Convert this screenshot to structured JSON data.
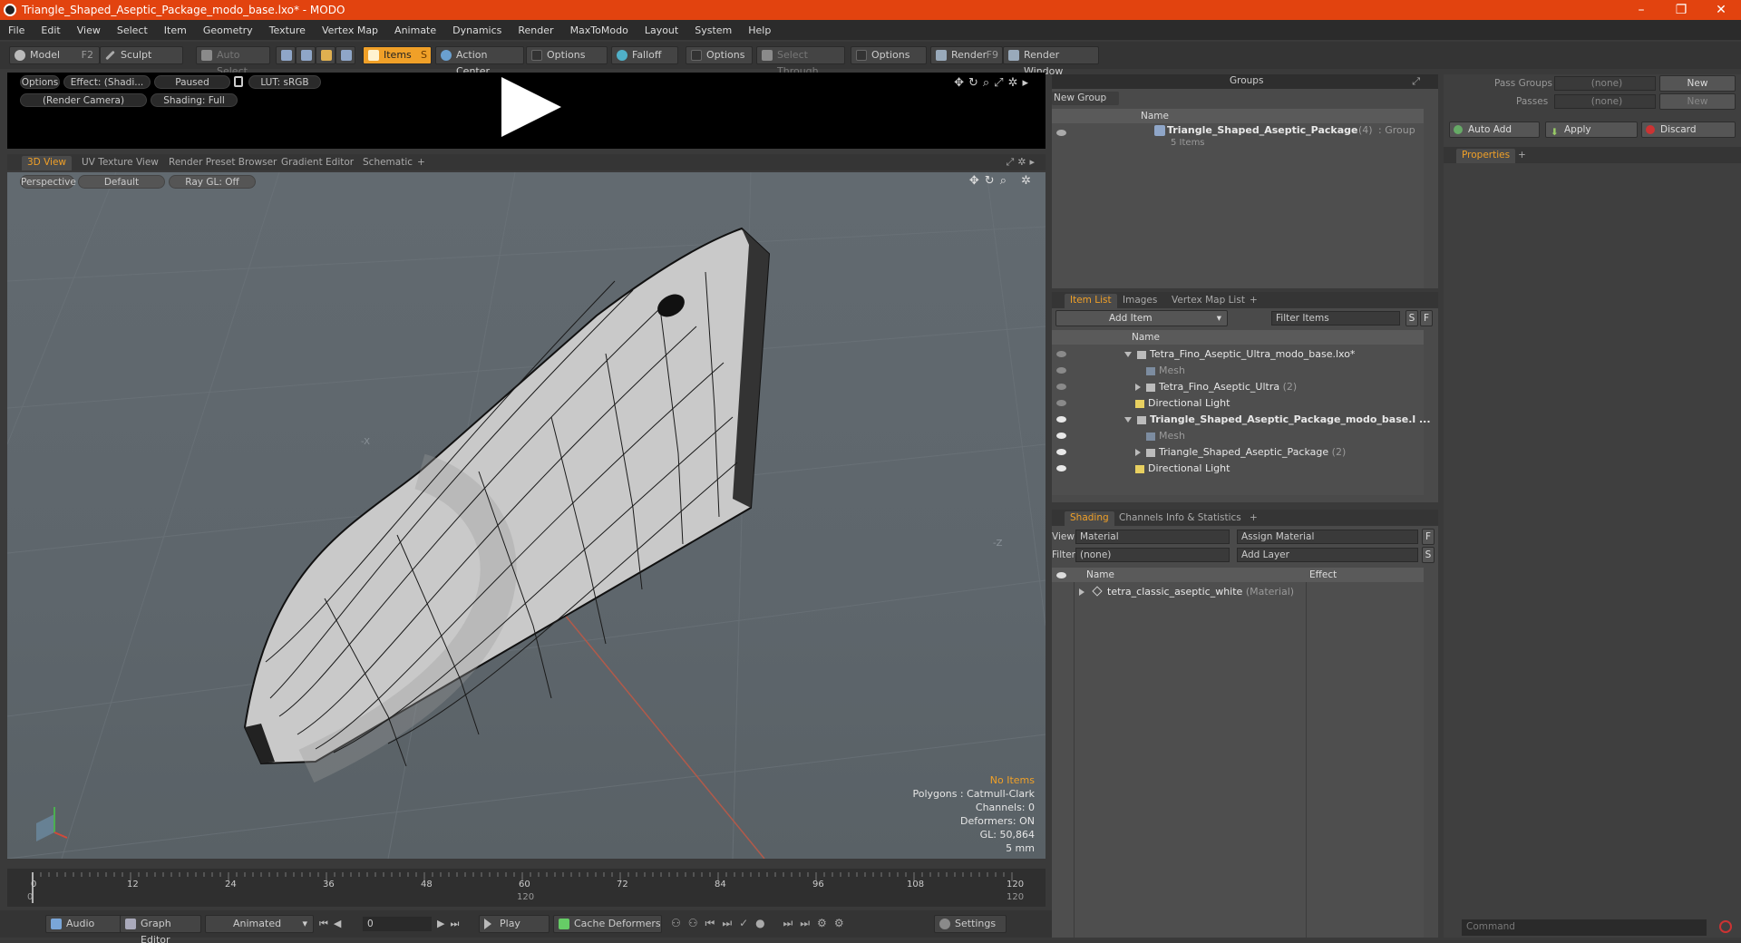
{
  "window": {
    "title": "Triangle_Shaped_Aseptic_Package_modo_base.lxo* - MODO",
    "controls": [
      "–",
      "❐",
      "✕"
    ]
  },
  "menu": [
    "File",
    "Edit",
    "View",
    "Select",
    "Item",
    "Geometry",
    "Texture",
    "Vertex Map",
    "Animate",
    "Dynamics",
    "Render",
    "MaxToModo",
    "Layout",
    "System",
    "Help"
  ],
  "toolbar": {
    "model": "Model",
    "model_key": "F2",
    "sculpt": "Sculpt",
    "auto_select": "Auto Select",
    "items": "Items",
    "items_key": "S",
    "action_center": "Action Center",
    "options1": "Options",
    "falloff": "Falloff",
    "options2": "Options",
    "select_through": "Select Through",
    "options3": "Options",
    "render": "Render",
    "render_key": "F9",
    "render_window": "Render Window"
  },
  "preview": {
    "options": "Options",
    "effect": "Effect: (Shadi...",
    "paused": "Paused",
    "lut": "LUT: sRGB",
    "camera": "(Render Camera)",
    "shading": "Shading: Full"
  },
  "viewport_tabs": [
    "3D View",
    "UV Texture View",
    "Render Preset Browser",
    "Gradient Editor",
    "Schematic",
    "+"
  ],
  "viewport": {
    "perspective": "Perspective",
    "default": "Default",
    "raygl": "Ray GL: Off",
    "stats": {
      "no_items": "No Items",
      "polygons": "Polygons : Catmull-Clark",
      "channels": "Channels: 0",
      "deformers": "Deformers: ON",
      "gl": "GL: 50,864",
      "unit": "5 mm"
    }
  },
  "timeline": {
    "ticks": [
      "0",
      "12",
      "24",
      "36",
      "48",
      "60",
      "72",
      "84",
      "96",
      "108",
      "120"
    ],
    "sub_ticks": [
      "0",
      "120",
      "120"
    ]
  },
  "bottombar": {
    "audio": "Audio",
    "graph_editor": "Graph Editor",
    "animated": "Animated",
    "frame": "0",
    "play": "Play",
    "cache_deformers": "Cache Deformers",
    "settings": "Settings"
  },
  "groups": {
    "title": "Groups",
    "new_group": "New Group",
    "col_name": "Name",
    "item_name": "Triangle_Shaped_Aseptic_Package",
    "item_count": "(4)",
    "item_type": ": Group",
    "item_sub": "5 Items"
  },
  "item_list": {
    "tabs": [
      "Item List",
      "Images",
      "Vertex Map List",
      "+"
    ],
    "add_item": "Add Item",
    "filter": "Filter Items",
    "s": "S",
    "f": "F",
    "col_name": "Name",
    "rows": [
      {
        "label": "Tetra_Fino_Aseptic_Ultra_modo_base.lxo*",
        "suffix": "",
        "indent": 0,
        "kind": "scene",
        "eye": false,
        "bold": false
      },
      {
        "label": "Mesh",
        "suffix": "",
        "indent": 2,
        "kind": "mesh",
        "eye": false,
        "bold": false,
        "muted": true
      },
      {
        "label": "Tetra_Fino_Aseptic_Ultra",
        "suffix": "(2)",
        "indent": 1,
        "kind": "group",
        "eye": false,
        "bold": false
      },
      {
        "label": "Directional Light",
        "suffix": "",
        "indent": 1,
        "kind": "light",
        "eye": false,
        "bold": false
      },
      {
        "label": "Triangle_Shaped_Aseptic_Package_modo_base.l ...",
        "suffix": "",
        "indent": 0,
        "kind": "scene",
        "eye": true,
        "bold": true
      },
      {
        "label": "Mesh",
        "suffix": "",
        "indent": 2,
        "kind": "mesh",
        "eye": true,
        "bold": false,
        "muted": true
      },
      {
        "label": "Triangle_Shaped_Aseptic_Package",
        "suffix": "(2)",
        "indent": 1,
        "kind": "group",
        "eye": true,
        "bold": false
      },
      {
        "label": "Directional Light",
        "suffix": "",
        "indent": 1,
        "kind": "light",
        "eye": true,
        "bold": false
      }
    ]
  },
  "shading": {
    "tabs": [
      "Shading",
      "Channels",
      "Info & Statistics",
      "+"
    ],
    "view_label": "View",
    "view_value": "Material",
    "assign_material": "Assign Material",
    "f": "F",
    "filter_label": "Filter",
    "filter_value": "(none)",
    "add_layer": "Add Layer",
    "s": "S",
    "col_name": "Name",
    "col_effect": "Effect",
    "material": "tetra_classic_aseptic_white",
    "material_type": "(Material)"
  },
  "pass": {
    "pass_groups": "Pass Groups",
    "pass_groups_value": "(none)",
    "new1": "New",
    "passes": "Passes",
    "passes_value": "(none)",
    "new2": "New",
    "auto_add": "Auto Add",
    "apply": "Apply",
    "discard": "Discard",
    "properties_tab": "Properties",
    "plus": "+"
  },
  "command": {
    "placeholder": "Command"
  },
  "colors": {
    "accent": "#f0a028",
    "titlebar": "#e2430f",
    "viewport": "#5f676d"
  }
}
